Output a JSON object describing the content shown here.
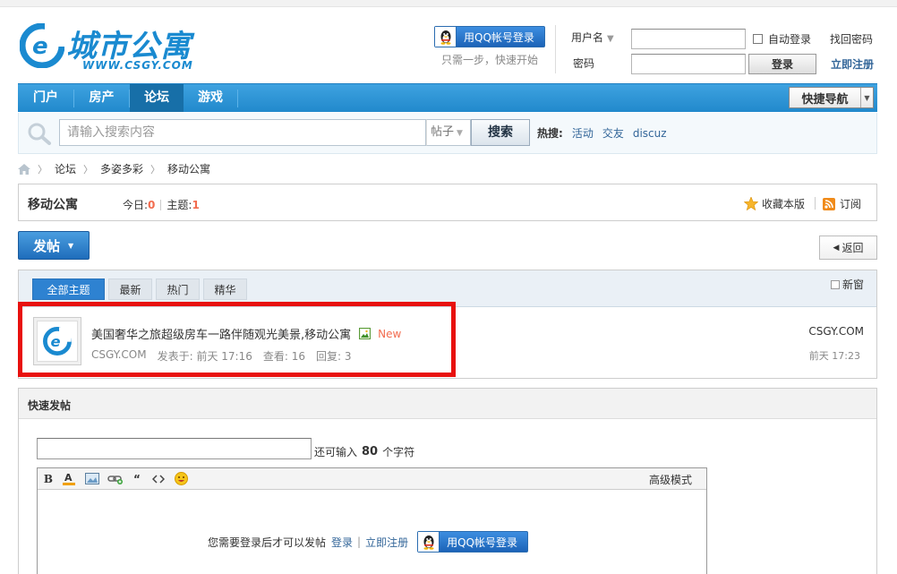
{
  "header": {
    "logo_text": "城市公寓",
    "logo_url": "WWW.CSGY.COM",
    "qq_login_label": "用QQ帐号登录",
    "qq_hint": "只需一步，快速开始",
    "username_label": "用户名",
    "password_label": "密码",
    "auto_login_label": "自动登录",
    "login_button": "登录",
    "find_password": "找回密码",
    "register": "立即注册",
    "username_value": "",
    "password_value": ""
  },
  "nav": {
    "items": [
      {
        "label": "门户"
      },
      {
        "label": "房产"
      },
      {
        "label": "论坛"
      },
      {
        "label": "游戏"
      }
    ],
    "active": "论坛",
    "quick_nav": "快捷导航"
  },
  "search": {
    "placeholder": "请输入搜索内容",
    "type": "帖子",
    "button": "搜索",
    "hot_label": "热搜:",
    "hot_items": [
      "活动",
      "交友",
      "discuz"
    ]
  },
  "breadcrumb": [
    "论坛",
    "多姿多彩",
    "移动公寓"
  ],
  "forum": {
    "title": "移动公寓",
    "today_label": "今日:",
    "today_value": "0",
    "topics_label": "主题:",
    "topics_value": "1",
    "favorite": "收藏本版",
    "subscribe": "订阅"
  },
  "actions": {
    "post_button": "发帖",
    "back_button": "返回"
  },
  "thread_list": {
    "tabs": [
      "全部主题",
      "最新",
      "热门",
      "精华"
    ],
    "active_tab": "全部主题",
    "new_window": "新窗",
    "threads": [
      {
        "title": "美国奢华之旅超级房车一路伴随观光美景,移动公寓",
        "new_tag": "New",
        "author": "CSGY.COM",
        "posted": "发表于: 前天 17:16",
        "views": "查看: 16",
        "replies": "回复: 3",
        "last_user": "CSGY.COM",
        "last_time": "前天 17:23"
      }
    ]
  },
  "quick_post": {
    "title": "快速发帖",
    "subject_value": "",
    "remain_prefix": "还可输入",
    "remain_count": "80",
    "remain_suffix": "个字符",
    "advanced_mode": "高级模式",
    "toolbar": [
      "bold-icon",
      "font-color-icon",
      "image-icon",
      "link-icon",
      "quote-icon",
      "code-icon",
      "emoji-icon"
    ],
    "need_login_text": "您需要登录后才可以发帖",
    "login_link": "登录",
    "register_link": "立即注册",
    "qq_login_label": "用QQ帐号登录"
  },
  "colors": {
    "nav_blue": "#2189cc",
    "accent_red": "#e8110e",
    "count_orange": "#f26c4f",
    "link_blue": "#336699"
  }
}
